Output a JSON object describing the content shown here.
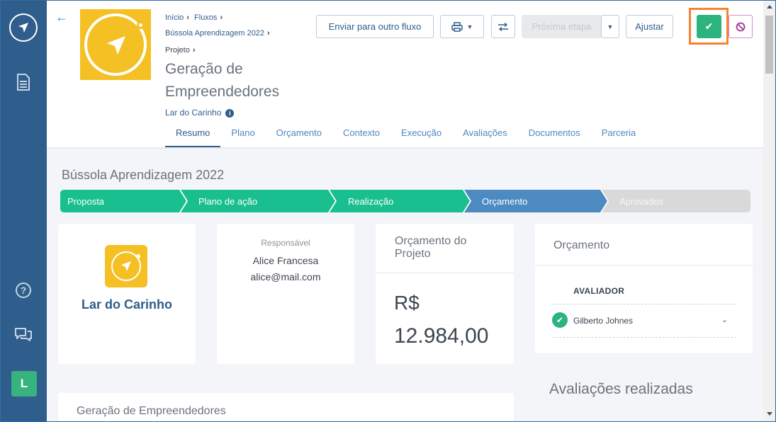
{
  "breadcrumb": {
    "items": [
      "Início",
      "Fluxos",
      "Bússola Aprendizagem 2022",
      "Projeto"
    ]
  },
  "header": {
    "title": "Geração de Empreendedores",
    "org_link": "Lar do Carinho",
    "buttons": {
      "send": "Enviar para outro fluxo",
      "next_step": "Próxima etapa",
      "adjust": "Ajustar"
    }
  },
  "tabs": [
    "Resumo",
    "Plano",
    "Orçamento",
    "Contexto",
    "Execução",
    "Avaliações",
    "Documentos",
    "Parceria"
  ],
  "active_tab": "Resumo",
  "main": {
    "flow_title": "Bússola Aprendizagem 2022",
    "steps": [
      {
        "label": "Proposta",
        "state": "done"
      },
      {
        "label": "Plano de ação",
        "state": "done"
      },
      {
        "label": "Realização",
        "state": "done"
      },
      {
        "label": "Orçamento",
        "state": "current"
      },
      {
        "label": "Aprovados",
        "state": "pending"
      }
    ],
    "org_card": {
      "name": "Lar do Carinho"
    },
    "responsible": {
      "label": "Responsável",
      "name": "Alice Francesa",
      "email": "alice@mail.com"
    },
    "budget": {
      "title": "Orçamento do Projeto",
      "currency": "R$",
      "value": "12.984,00"
    },
    "review": {
      "title": "Orçamento",
      "column": "AVALIADOR",
      "reviewer": "Gilberto Johnes",
      "status": "approved"
    },
    "evaluations_title": "Avaliações realizadas",
    "bottom_card_title": "Geração de Empreendedores"
  },
  "sidebar": {
    "avatar_initial": "L",
    "icons": [
      "compass-logo-icon",
      "document-icon",
      "help-icon",
      "chat-icon"
    ]
  },
  "colors": {
    "sidebar": "#2f5d8c",
    "step_done": "#19bf8f",
    "step_current": "#4d8ac2",
    "step_pending": "#d9d9d9",
    "accent": "#2f5d8c",
    "approve": "#2db37d",
    "highlight": "#f7822f",
    "logo_yellow": "#f5c024"
  }
}
